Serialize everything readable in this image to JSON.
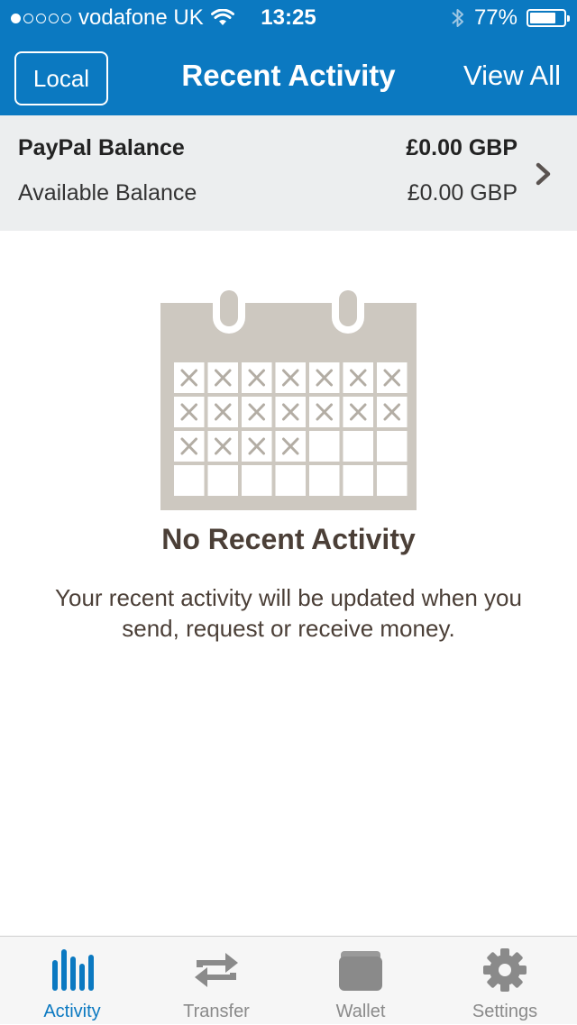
{
  "status_bar": {
    "carrier": "vodafone UK",
    "signal_bars_filled": 1,
    "signal_bars_total": 5,
    "time": "13:25",
    "battery_percent": "77%",
    "battery_level": 0.77
  },
  "nav": {
    "left_button": "Local",
    "title": "Recent Activity",
    "right_button": "View All"
  },
  "balance": {
    "label": "PayPal Balance",
    "amount": "£0.00 GBP",
    "available_label": "Available Balance",
    "available_amount": "£0.00 GBP"
  },
  "empty_state": {
    "title": "No Recent Activity",
    "message": "Your recent activity will be updated when you send, request or receive money.",
    "illustration": "calendar-icon",
    "crossed_days": 18
  },
  "tabs": [
    {
      "label": "Activity",
      "icon": "activity-icon",
      "active": true
    },
    {
      "label": "Transfer",
      "icon": "transfer-icon",
      "active": false
    },
    {
      "label": "Wallet",
      "icon": "wallet-icon",
      "active": false
    },
    {
      "label": "Settings",
      "icon": "gear-icon",
      "active": false
    }
  ],
  "colors": {
    "brand_blue": "#0b79c1",
    "calendar_gray": "#cdc8c0",
    "text_brown": "#4b3f37",
    "tab_inactive": "#8a8a8a"
  }
}
